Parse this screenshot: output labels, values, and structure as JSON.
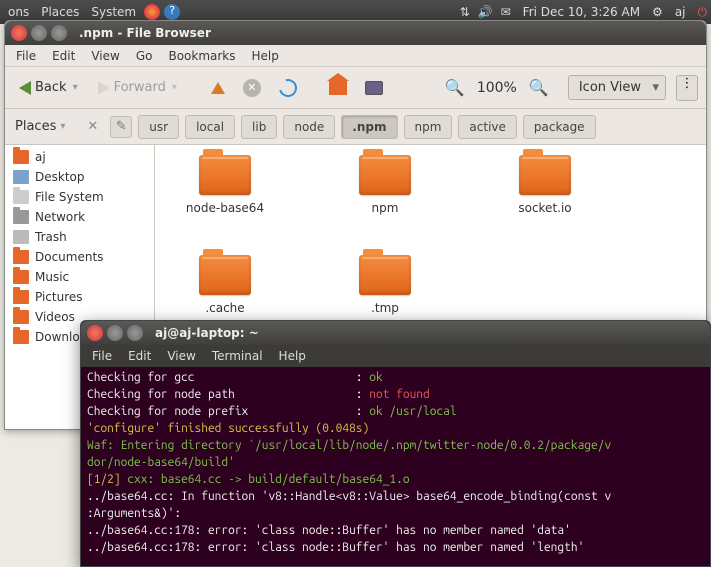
{
  "panel": {
    "apps": "ons",
    "places": "Places",
    "system": "System",
    "clock": "Fri Dec 10,  3:26 AM",
    "user": "aj"
  },
  "file_browser": {
    "title": ".npm - File Browser",
    "menus": [
      "File",
      "Edit",
      "View",
      "Go",
      "Bookmarks",
      "Help"
    ],
    "back": "Back",
    "forward": "Forward",
    "zoom": "100%",
    "view_mode": "Icon View",
    "places_label": "Places",
    "path": [
      "usr",
      "local",
      "lib",
      "node",
      ".npm",
      "npm",
      "active",
      "package"
    ],
    "path_active_index": 4,
    "sidebar": [
      {
        "label": "aj",
        "icon": "home"
      },
      {
        "label": "Desktop",
        "icon": "desktop"
      },
      {
        "label": "File System",
        "icon": "fs"
      },
      {
        "label": "Network",
        "icon": "net"
      },
      {
        "label": "Trash",
        "icon": "trash"
      },
      {
        "label": "Documents",
        "icon": "docs"
      },
      {
        "label": "Music",
        "icon": "docs"
      },
      {
        "label": "Pictures",
        "icon": "docs"
      },
      {
        "label": "Videos",
        "icon": "docs"
      },
      {
        "label": "Downloa",
        "icon": "docs"
      }
    ],
    "folders": [
      "node-base64",
      "npm",
      "socket.io",
      ".cache",
      ".tmp"
    ]
  },
  "terminal": {
    "title": "aj@aj-laptop: ~",
    "menus": [
      "File",
      "Edit",
      "View",
      "Terminal",
      "Help"
    ],
    "lines": [
      {
        "segs": [
          {
            "t": "Checking for gcc                        : "
          },
          {
            "t": "ok",
            "c": "c-green"
          }
        ]
      },
      {
        "segs": [
          {
            "t": "Checking for node path                  : "
          },
          {
            "t": "not found",
            "c": "c-red"
          }
        ]
      },
      {
        "segs": [
          {
            "t": "Checking for node prefix                : "
          },
          {
            "t": "ok /usr/local",
            "c": "c-green"
          }
        ]
      },
      {
        "segs": [
          {
            "t": "'configure' finished successfully (0.048s)",
            "c": "c-yellow"
          }
        ]
      },
      {
        "segs": [
          {
            "t": "Waf: Entering directory `/usr/local/lib/node/.npm/twitter-node/0.0.2/package/v",
            "c": "c-green"
          }
        ]
      },
      {
        "segs": [
          {
            "t": "dor/node-base64/build'",
            "c": "c-green"
          }
        ]
      },
      {
        "segs": [
          {
            "t": "[1/2] ",
            "c": "c-yellow"
          },
          {
            "t": "cxx: base64.cc -> build/default/base64_1.o",
            "c": "c-green"
          }
        ]
      },
      {
        "segs": [
          {
            "t": "../base64.cc: In function 'v8::Handle<v8::Value> base64_encode_binding(const v"
          }
        ]
      },
      {
        "segs": [
          {
            "t": ":Arguments&)':"
          }
        ]
      },
      {
        "segs": [
          {
            "t": "../base64.cc:178: error: 'class node::Buffer' has no member named 'data'"
          }
        ]
      },
      {
        "segs": [
          {
            "t": "../base64.cc:178: error: 'class node::Buffer' has no member named 'length'"
          }
        ]
      }
    ]
  }
}
